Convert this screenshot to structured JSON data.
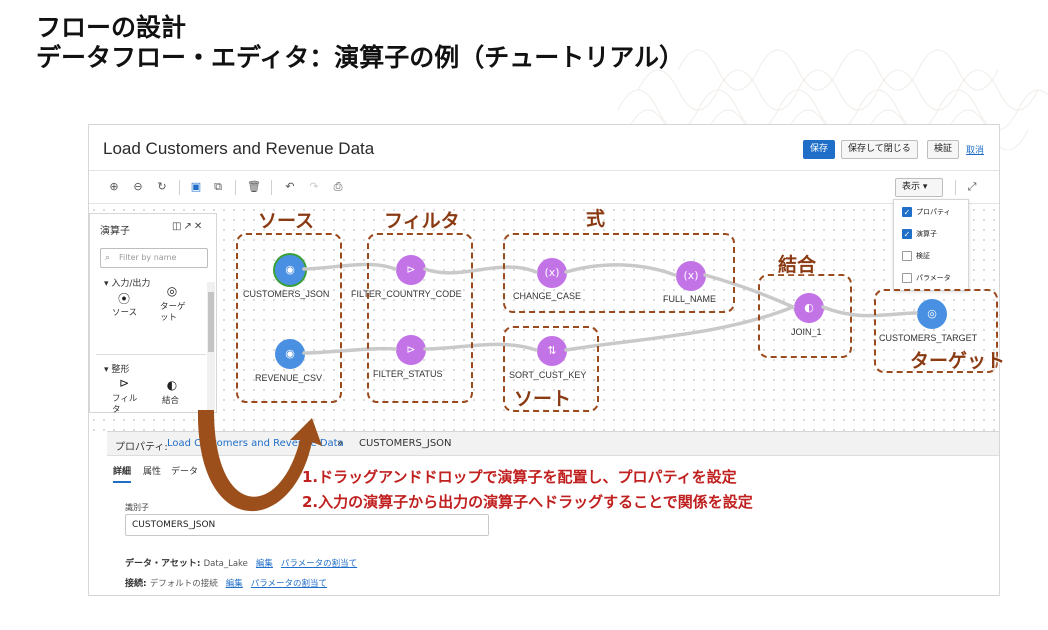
{
  "title": {
    "line1": "フローの設計",
    "line2": "データフロー・エディタ：演算子の例（チュートリアル）"
  },
  "app": {
    "window_title": "Load Customers and Revenue Data",
    "save": "保存",
    "save_close": "保存して閉じる",
    "validate": "検証",
    "cancel": "取消",
    "view_menu": "表示 ▾"
  },
  "toolbar": {
    "icons": [
      "zoom-in-icon",
      "zoom-out-icon",
      "reset-icon",
      "select-icon",
      "copy-icon",
      "delete-icon",
      "undo-icon",
      "redo-icon",
      "print-icon",
      "expand-icon"
    ]
  },
  "view_menu": {
    "items": [
      {
        "label": "プロパティ",
        "checked": true
      },
      {
        "label": "演算子",
        "checked": true
      },
      {
        "label": "検証",
        "checked": false
      },
      {
        "label": "パラメータ",
        "checked": false
      }
    ]
  },
  "palette": {
    "title": "演算子",
    "filter_placeholder": "Filter by name",
    "section_io": "入力/出力",
    "section_shape": "整形",
    "item_source": "ソース",
    "item_target": "ターゲット",
    "item_filter": "フィルタ",
    "item_join": "結合"
  },
  "nodes": {
    "customers_json": "CUSTOMERS_JSON",
    "revenue_csv": "REVENUE_CSV",
    "filter_country_code": "FILTER_COUNTRY_CODE",
    "filter_status": "FILTER_STATUS",
    "change_case": "CHANGE_CASE",
    "full_name": "FULL_NAME",
    "sort_cust_key": "SORT_CUST_KEY",
    "join_1": "JOIN_1",
    "customers_target": "CUSTOMERS_TARGET"
  },
  "annotations": {
    "source": "ソース",
    "filter": "フィルタ",
    "expression": "式",
    "join": "結合",
    "sort": "ソート",
    "target": "ターゲット",
    "step1": "1.ドラッグアンドドロップで演算子を配置し、プロパティを設定",
    "step2": "2.入力の演算子から出力の演算子へドラッグすることで関係を設定"
  },
  "properties": {
    "header_prefix": "プロパティ: ",
    "header_link": "Load Customers and Revenue Data",
    "header_sep": " » ",
    "header_current": "CUSTOMERS_JSON",
    "tab_details": "詳細",
    "tab_attributes": "属性",
    "tab_data": "データ",
    "identifier_label": "識別子",
    "identifier_value": "CUSTOMERS_JSON",
    "asset_label": "データ・アセット: ",
    "asset_value": "Data_Lake",
    "connection_label": "接続: ",
    "connection_value": "デフォルトの接続",
    "edit": "編集",
    "assign_param": "パラメータの割当て"
  },
  "colors": {
    "annotation": "#9b4a1e",
    "instruction": "#c0201f",
    "node_blue": "#4a90e2",
    "node_purple": "#c273e6",
    "primary": "#1f6fc9"
  }
}
